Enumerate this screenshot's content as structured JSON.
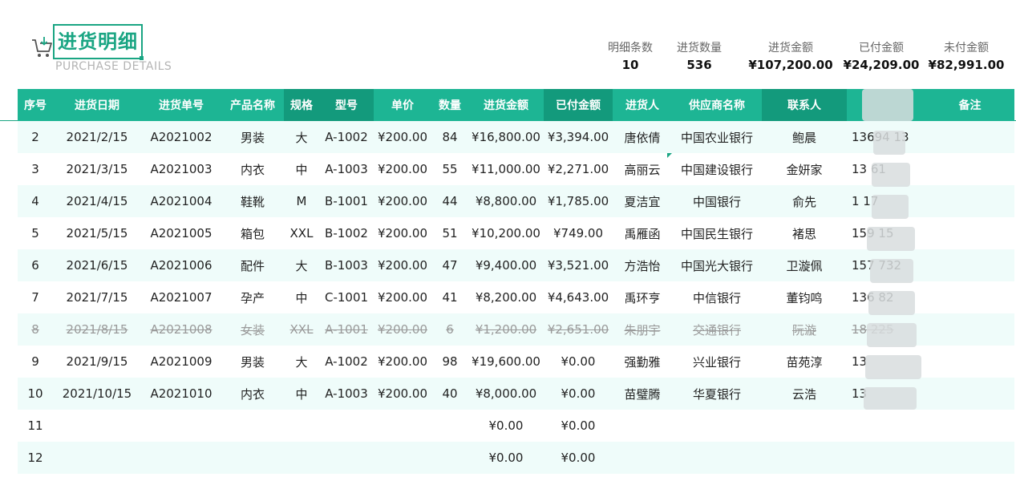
{
  "header": {
    "title": "进货明细",
    "subtitle": "PURCHASE DETAILS"
  },
  "summary": [
    {
      "label": "明细条数",
      "value": "10"
    },
    {
      "label": "进货数量",
      "value": "536"
    },
    {
      "label": "进货金额",
      "value": "¥107,200.00"
    },
    {
      "label": "已付金额",
      "value": "¥24,209.00"
    },
    {
      "label": "未付金额",
      "value": "¥82,991.00"
    }
  ],
  "columns": [
    "序号",
    "进货日期",
    "进货单号",
    "产品名称",
    "规格",
    "型号",
    "单价",
    "数量",
    "进货金额",
    "已付金额",
    "进货人",
    "供应商名称",
    "联系人",
    "",
    "备注"
  ],
  "rows": [
    [
      "2",
      "2021/2/15",
      "A2021002",
      "男装",
      "大",
      "A-1002",
      "¥200.00",
      "84",
      "¥16,800.00",
      "¥3,394.00",
      "唐依倩",
      "中国农业银行",
      "鲍晨",
      "13694    13",
      ""
    ],
    [
      "3",
      "2021/3/15",
      "A2021003",
      "内衣",
      "中",
      "A-1003",
      "¥200.00",
      "55",
      "¥11,000.00",
      "¥2,271.00",
      "高丽云",
      "中国建设银行",
      "金妍家",
      "13       61",
      ""
    ],
    [
      "4",
      "2021/4/15",
      "A2021004",
      "鞋靴",
      "M",
      "B-1001",
      "¥200.00",
      "44",
      "¥8,800.00",
      "¥1,785.00",
      "夏洁宜",
      "中国银行",
      "俞先",
      "1        17",
      ""
    ],
    [
      "5",
      "2021/5/15",
      "A2021005",
      "箱包",
      "XXL",
      "B-1002",
      "¥200.00",
      "51",
      "¥10,200.00",
      "¥749.00",
      "禹雁函",
      "中国民生银行",
      "褚思",
      "159      15",
      ""
    ],
    [
      "6",
      "2021/6/15",
      "A2021006",
      "配件",
      "大",
      "B-1003",
      "¥200.00",
      "47",
      "¥9,400.00",
      "¥3,521.00",
      "方浩怡",
      "中国光大银行",
      "卫漩佩",
      "157     732",
      ""
    ],
    [
      "7",
      "2021/7/15",
      "A2021007",
      "孕产",
      "中",
      "C-1001",
      "¥200.00",
      "41",
      "¥8,200.00",
      "¥4,643.00",
      "禹环亨",
      "中信银行",
      "董钧鸣",
      "136      82",
      ""
    ],
    [
      "8",
      "2021/8/15",
      "A2021008",
      "女装",
      "XXL",
      "A-1001",
      "¥200.00",
      "6",
      "¥1,200.00",
      "¥2,651.00",
      "朱朋宇",
      "交通银行",
      "阮漩",
      "18      225",
      ""
    ],
    [
      "9",
      "2021/9/15",
      "A2021009",
      "男装",
      "大",
      "A-1002",
      "¥200.00",
      "98",
      "¥19,600.00",
      "¥0.00",
      "强勤雅",
      "兴业银行",
      "苗苑淳",
      "13",
      ""
    ],
    [
      "10",
      "2021/10/15",
      "A2021010",
      "内衣",
      "中",
      "A-1003",
      "¥200.00",
      "40",
      "¥8,000.00",
      "¥0.00",
      "苗璧腾",
      "华夏银行",
      "云浩",
      "13",
      ""
    ],
    [
      "11",
      "",
      "",
      "",
      "",
      "",
      "",
      "",
      "¥0.00",
      "¥0.00",
      "",
      "",
      "",
      "",
      ""
    ],
    [
      "12",
      "",
      "",
      "",
      "",
      "",
      "",
      "",
      "¥0.00",
      "¥0.00",
      "",
      "",
      "",
      "",
      ""
    ]
  ],
  "colors": {
    "accent": "#1db594",
    "accent_dark": "#139a7c",
    "row_alt": "#effcfa"
  }
}
